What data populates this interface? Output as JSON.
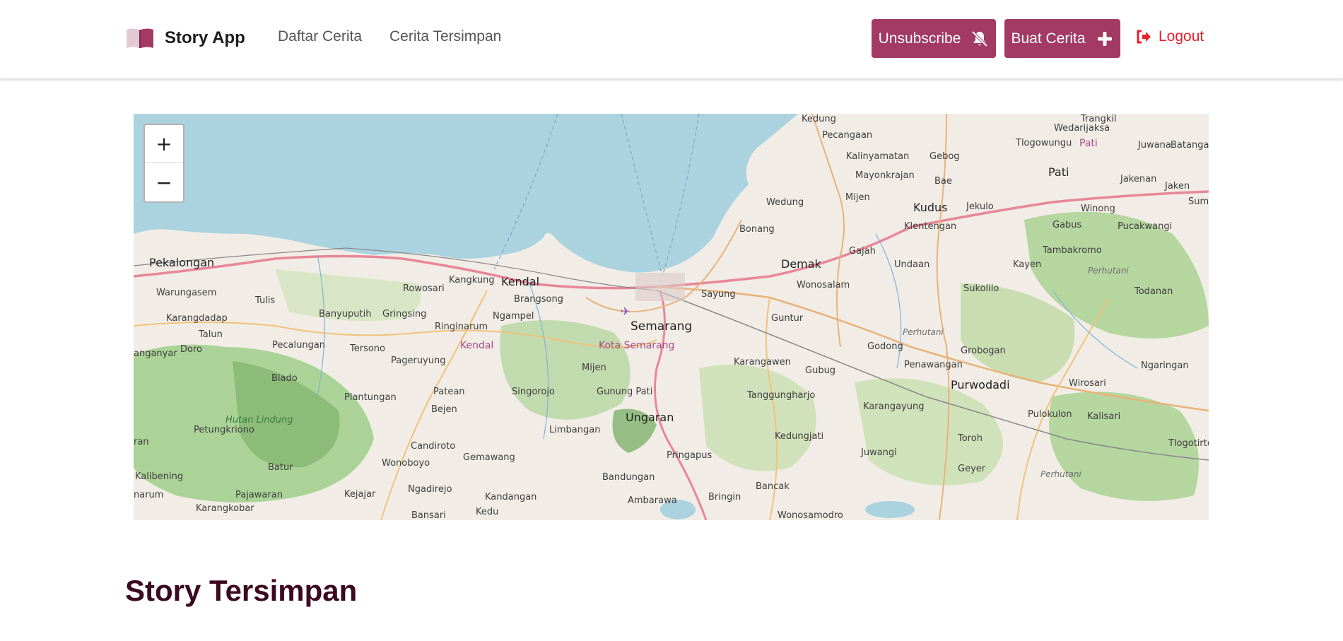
{
  "brand": {
    "name": "Story App",
    "icon": "book-icon"
  },
  "nav": {
    "links": [
      "Daftar Cerita",
      "Cerita Tersimpan"
    ]
  },
  "actions": {
    "unsubscribe_label": "Unsubscribe",
    "unsubscribe_icon": "bell-slash-icon",
    "create_label": "Buat Cerita",
    "create_icon": "plus-icon",
    "logout_label": "Logout",
    "logout_icon": "sign-out-icon"
  },
  "map": {
    "zoom_in": "+",
    "zoom_out": "−",
    "labels": {
      "pekalongan": "Pekalongan",
      "warungasem": "Warungasem",
      "tulis": "Tulis",
      "karangdadap": "Karangdadap",
      "talun": "Talun",
      "doro": "Doro",
      "anganyar": "anganyar",
      "pecalungan": "Pecalungan",
      "banyuputih": "Banyuputih",
      "gringsing": "Gringsing",
      "rowosari": "Rowosari",
      "kangkung": "Kangkung",
      "kendal": "Kendal",
      "brangsong": "Brangsong",
      "ringinarum": "Ringinarum",
      "ngampel": "Ngampel",
      "kendal_area": "Kendal",
      "tersono": "Tersono",
      "pageruyung": "Pageruyung",
      "blado": "Blado",
      "plantungan": "Plantungan",
      "patean": "Patean",
      "singorojo": "Singorojo",
      "bejen": "Bejen",
      "hutan_lindung": "Hutan Lindung",
      "petungkriono": "Petungkriono",
      "candiroto": "Candiroto",
      "wonoboyo": "Wonoboyo",
      "gemawang": "Gemawang",
      "batur": "Batur",
      "ngadirejo": "Ngadirejo",
      "kandangan": "Kandangan",
      "kedu": "Kedu",
      "bansari": "Bansari",
      "kejajar": "Kejajar",
      "pajawaran": "Pajawaran",
      "karangkobar": "Karangkobar",
      "kalibening": "Kalibening",
      "narum": "narum",
      "ran": "ran",
      "semarang": "Semarang",
      "kota_semarang": "Kota Semarang",
      "mijen": "Mijen",
      "gunung_pati": "Gunung Pati",
      "limbangan": "Limbangan",
      "ungaran": "Ungaran",
      "pringapus": "Pringapus",
      "bandungan": "Bandungan",
      "ambarawa": "Ambarawa",
      "bringin": "Bringin",
      "bancak": "Bancak",
      "wonosamodro": "Wonosamodro",
      "sayung": "Sayung",
      "guntur": "Guntur",
      "karangawen": "Karangawen",
      "tanggungharjo": "Tanggungharjo",
      "kedungjati": "Kedungjati",
      "juwangi": "Juwangi",
      "gubug": "Gubug",
      "karangayung": "Karangayung",
      "godong": "Godong",
      "demak": "Demak",
      "wonosalam": "Wonosalam",
      "bonang": "Bonang",
      "wedung": "Wedung",
      "kedung": "Kedung",
      "pecangaan": "Pecangaan",
      "kalinyamatan": "Kalinyamatan",
      "mayonkrajan": "Mayonkrajan",
      "gebog": "Gebog",
      "bae": "Bae",
      "mijen_demak": "Mijen",
      "kudus": "Kudus",
      "jekulo": "Jekulo",
      "klentengan": "Klentengan",
      "gajah": "Gajah",
      "undaan": "Undaan",
      "pati": "Pati",
      "tlogowungu": "Tlogowungu",
      "wedarijaksa": "Wedarijaksa",
      "trangkil": "Trangkil",
      "pati_small": "Pati",
      "juwana": "Juwana",
      "batangan": "Batangan",
      "jakenan": "Jakenan",
      "jaken": "Jaken",
      "sumbe": "Sumbe",
      "winong": "Winong",
      "gabus": "Gabus",
      "pucakwangi": "Pucakwangi",
      "tambakromo": "Tambakromo",
      "kayen": "Kayen",
      "perhutani1": "Perhutani",
      "sukolilo": "Sukolilo",
      "todanan": "Todanan",
      "perhutani2": "Perhutani",
      "grobogan": "Grobogan",
      "penawangan": "Penawangan",
      "ngaringan": "Ngaringan",
      "wirosari": "Wirosari",
      "purwodadi": "Purwodadi",
      "pulokulon": "Pulokulon",
      "kalisari": "Kalisari",
      "toroh": "Toroh",
      "tlogotirto": "Tlogotirto",
      "geyer": "Geyer",
      "perhutani3": "Perhutani"
    }
  },
  "section": {
    "title": "Story Tersimpan"
  }
}
